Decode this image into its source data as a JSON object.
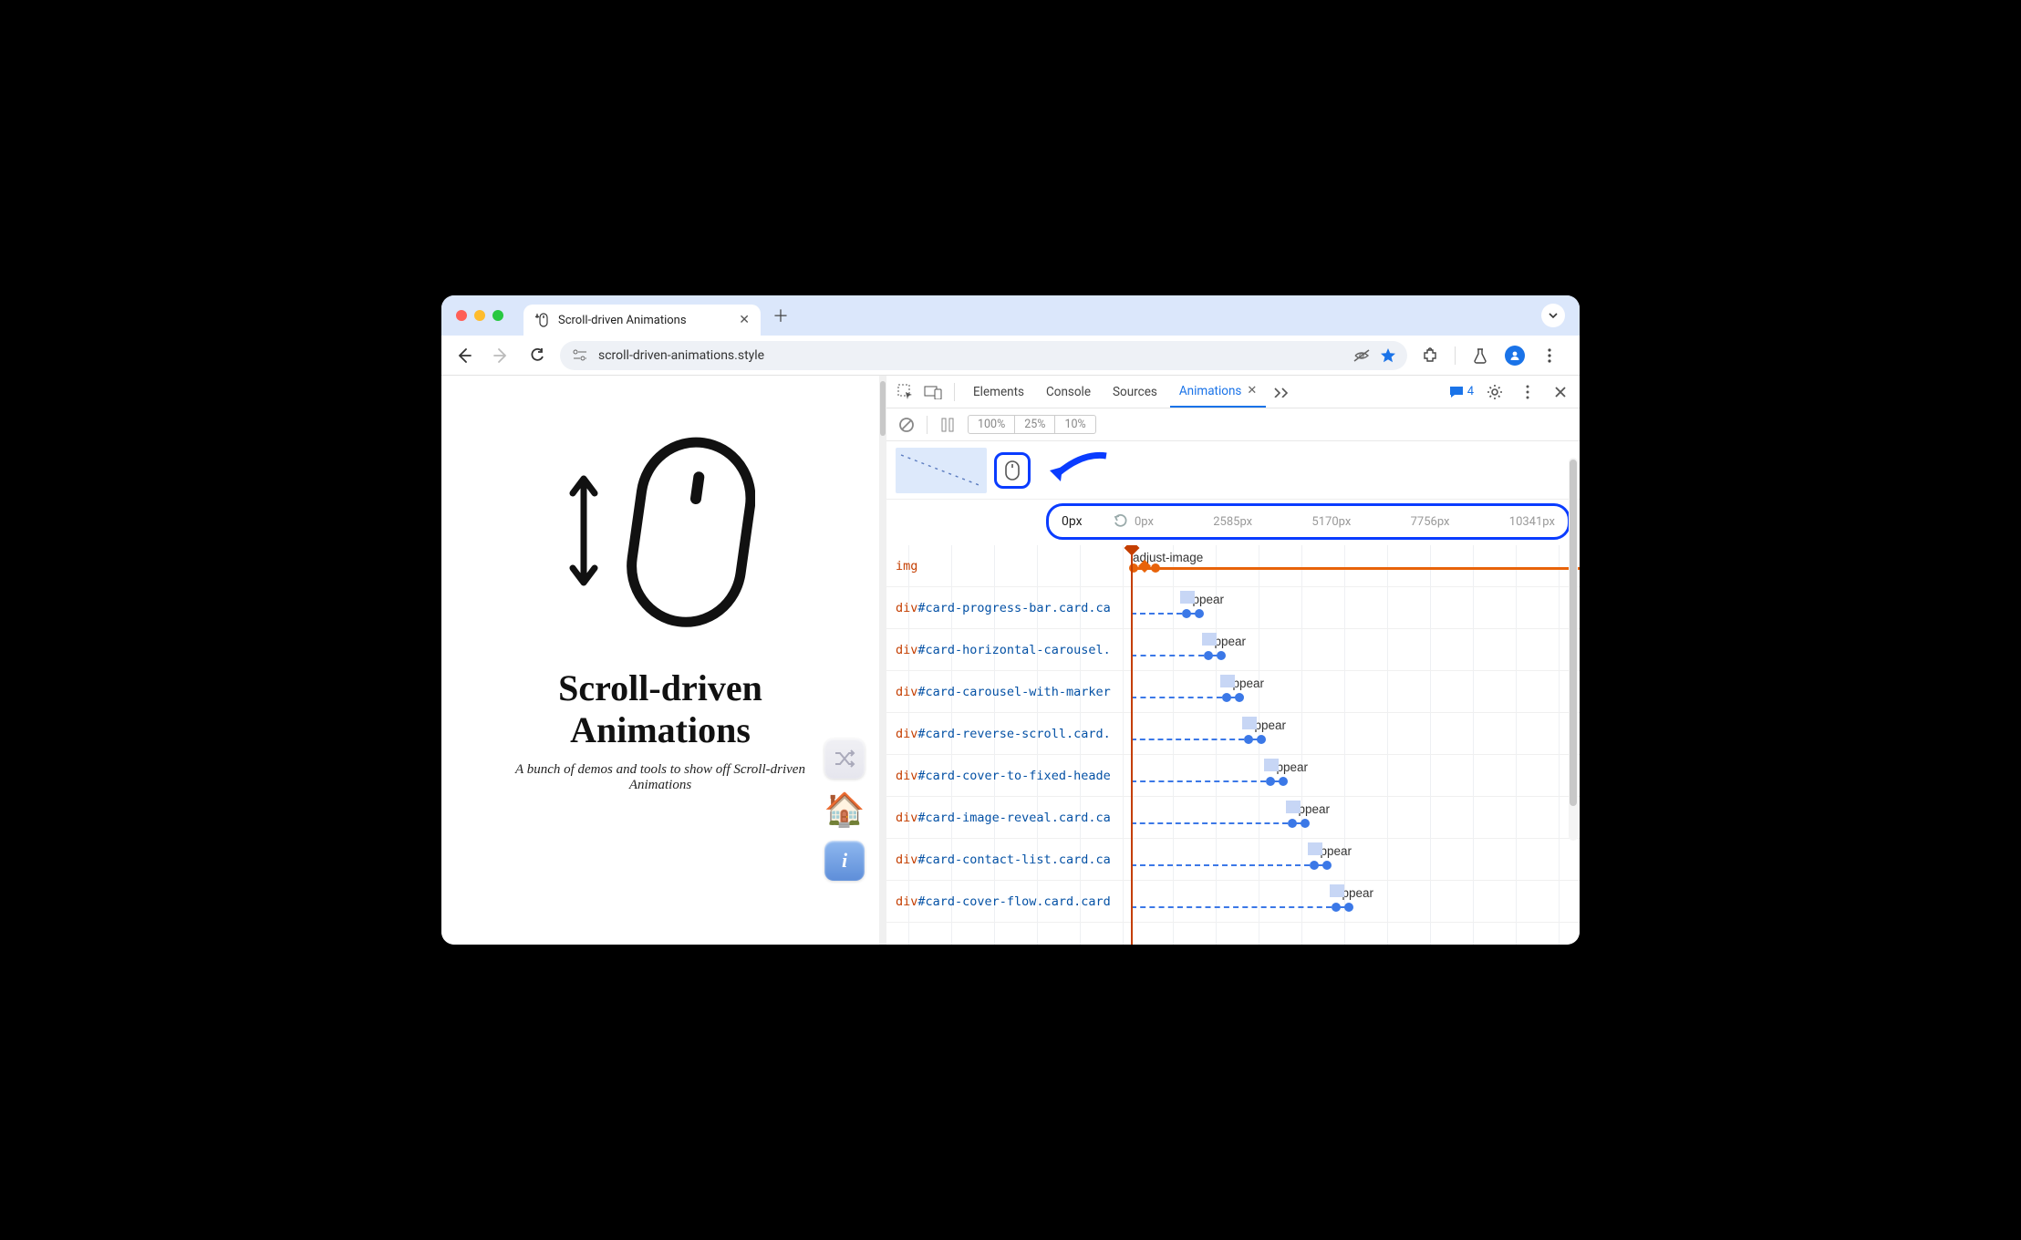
{
  "tab": {
    "title": "Scroll-driven Animations"
  },
  "toolbar": {
    "url": "scroll-driven-animations.style"
  },
  "page": {
    "title_line1": "Scroll-driven",
    "title_line2": "Animations",
    "subtitle": "A bunch of demos and tools to show off Scroll-driven Animations"
  },
  "devtools": {
    "tabs": {
      "elements": "Elements",
      "console": "Console",
      "sources": "Sources",
      "animations": "Animations"
    },
    "issues_count": "4",
    "speeds": {
      "s100": "100%",
      "s25": "25%",
      "s10": "10%"
    },
    "ruler": {
      "current": "0px",
      "ticks": [
        "0px",
        "2585px",
        "5170px",
        "7756px",
        "10341px"
      ]
    },
    "rows": [
      {
        "tag": "img",
        "rest": "",
        "anim": "adjust-image",
        "offset": 0,
        "kind": "img"
      },
      {
        "tag": "div",
        "rest": "#card-progress-bar.card.ca",
        "anim": "appear",
        "offset": 56
      },
      {
        "tag": "div",
        "rest": "#card-horizontal-carousel.",
        "anim": "appear",
        "offset": 80
      },
      {
        "tag": "div",
        "rest": "#card-carousel-with-marker",
        "anim": "appear",
        "offset": 100
      },
      {
        "tag": "div",
        "rest": "#card-reverse-scroll.card.",
        "anim": "appear",
        "offset": 124
      },
      {
        "tag": "div",
        "rest": "#card-cover-to-fixed-heade",
        "anim": "appear",
        "offset": 148
      },
      {
        "tag": "div",
        "rest": "#card-image-reveal.card.ca",
        "anim": "appear",
        "offset": 172
      },
      {
        "tag": "div",
        "rest": "#card-contact-list.card.ca",
        "anim": "appear",
        "offset": 196
      },
      {
        "tag": "div",
        "rest": "#card-cover-flow.card.card",
        "anim": "appear",
        "offset": 220
      }
    ]
  }
}
